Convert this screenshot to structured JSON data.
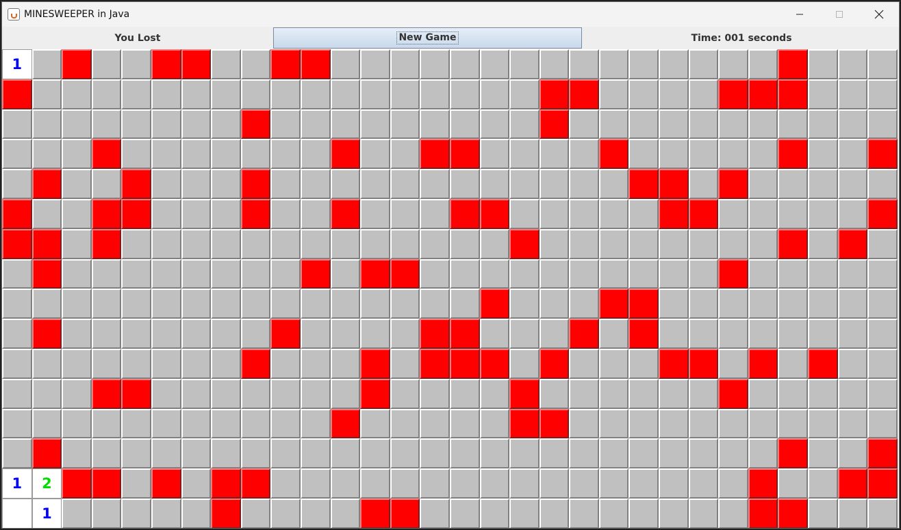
{
  "window": {
    "title": "MINESWEEPER in Java",
    "icon": "java-cup-icon",
    "controls": [
      {
        "name": "minimize-button",
        "glyph": "—"
      },
      {
        "name": "maximize-button",
        "glyph": "☐"
      },
      {
        "name": "close-button",
        "glyph": "✕"
      }
    ]
  },
  "status": {
    "message": "You Lost",
    "new_game_label": "New Game",
    "timer": "Time: 001 seconds"
  },
  "board": {
    "rows": 16,
    "cols": 30,
    "cell_color": "#c0c0c0",
    "mine_color": "#ff0000",
    "number_colors": {
      "1": "#0000ff",
      "2": "#00dd00"
    },
    "mine_rows": [
      [
        2,
        5,
        6,
        9,
        10,
        26
      ],
      [
        0,
        18,
        19,
        24,
        25,
        26
      ],
      [
        8,
        18
      ],
      [
        3,
        11,
        14,
        15,
        20,
        26,
        29
      ],
      [
        1,
        4,
        8,
        21,
        22,
        24
      ],
      [
        0,
        3,
        4,
        8,
        11,
        15,
        16,
        22,
        23,
        29
      ],
      [
        0,
        1,
        3,
        17,
        26,
        28
      ],
      [
        1,
        10,
        12,
        13,
        24
      ],
      [
        16,
        20,
        21
      ],
      [
        1,
        9,
        14,
        15,
        19,
        21
      ],
      [
        8,
        12,
        14,
        15,
        16,
        18,
        22,
        23,
        25,
        27
      ],
      [
        3,
        4,
        12,
        17,
        24
      ],
      [
        11,
        17,
        18
      ],
      [
        1,
        26,
        29
      ],
      [
        2,
        3,
        5,
        7,
        8,
        25,
        28,
        29
      ],
      [
        7,
        12,
        13,
        25,
        26
      ]
    ],
    "revealed": [
      {
        "row": 0,
        "col": 0,
        "value": "1"
      },
      {
        "row": 14,
        "col": 0,
        "value": "1"
      },
      {
        "row": 14,
        "col": 1,
        "value": "2"
      },
      {
        "row": 15,
        "col": 0,
        "value": ""
      },
      {
        "row": 15,
        "col": 1,
        "value": "1"
      }
    ]
  }
}
